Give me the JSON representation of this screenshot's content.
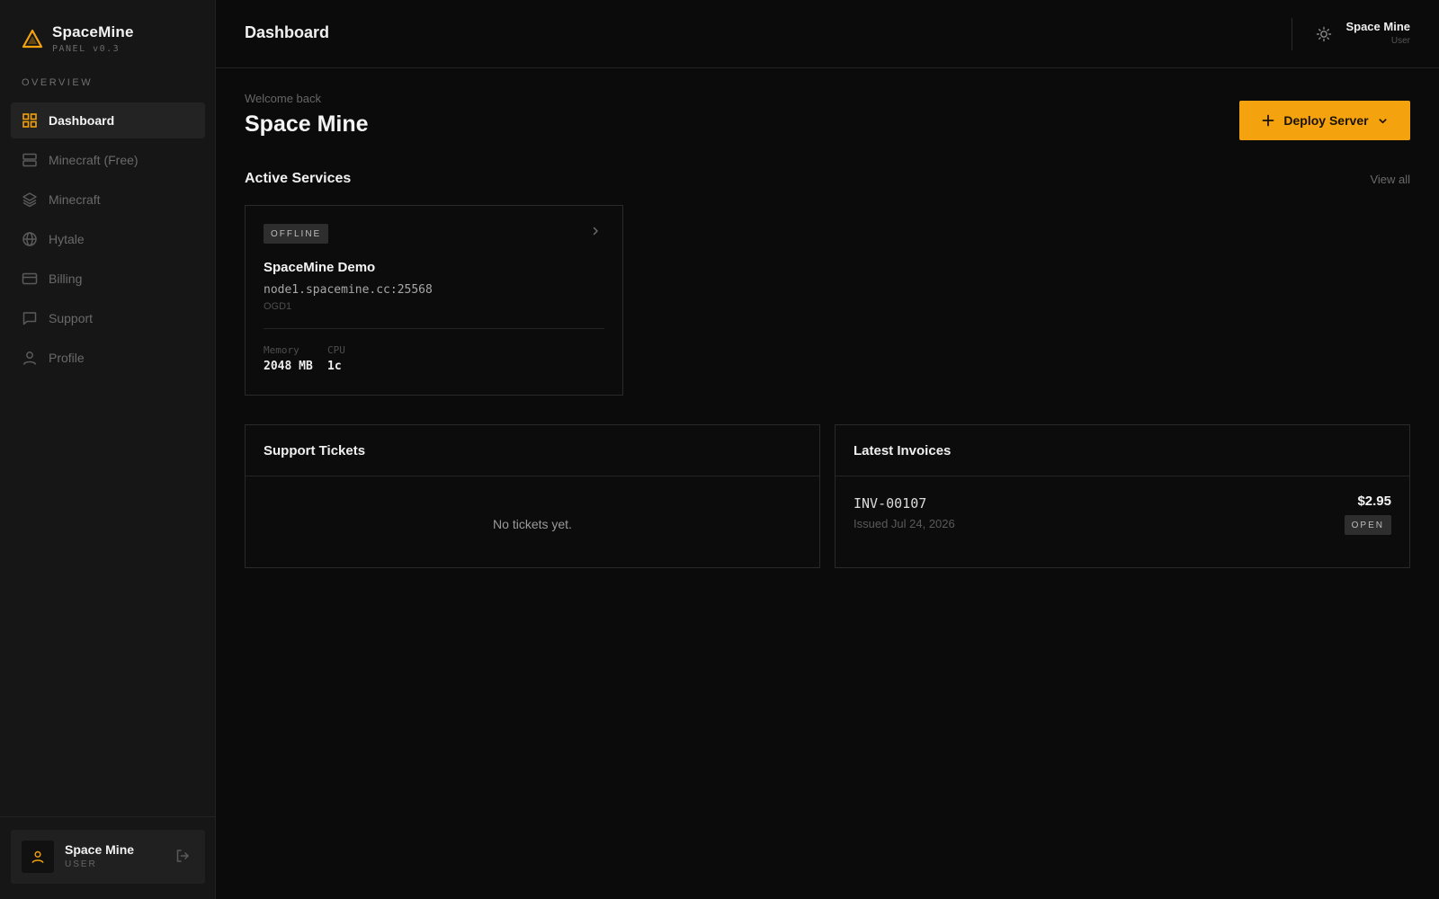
{
  "brand": {
    "name": "SpaceMine",
    "version": "PANEL v0.3",
    "accent": "#f4a20e"
  },
  "sidebar": {
    "section_label": "OVERVIEW",
    "items": [
      {
        "label": "Dashboard",
        "icon": "grid-icon",
        "active": true
      },
      {
        "label": "Minecraft (Free)",
        "icon": "server-icon",
        "active": false
      },
      {
        "label": "Minecraft",
        "icon": "layers-icon",
        "active": false
      },
      {
        "label": "Hytale",
        "icon": "globe-icon",
        "active": false
      },
      {
        "label": "Billing",
        "icon": "credit-card-icon",
        "active": false
      },
      {
        "label": "Support",
        "icon": "chat-icon",
        "active": false
      },
      {
        "label": "Profile",
        "icon": "user-icon",
        "active": false
      }
    ],
    "user": {
      "name": "Space Mine",
      "role": "USER"
    }
  },
  "topbar": {
    "title": "Dashboard",
    "user": {
      "name": "Space Mine",
      "role": "User"
    }
  },
  "main": {
    "welcome": "Welcome back",
    "greeting": "Space Mine",
    "deploy_label": "Deploy Server",
    "services": {
      "title": "Active Services",
      "view_all": "View all",
      "items": [
        {
          "status": "OFFLINE",
          "name": "SpaceMine Demo",
          "address": "node1.spacemine.cc:25568",
          "node": "OGD1",
          "memory_label": "Memory",
          "memory_value": "2048 MB",
          "cpu_label": "CPU",
          "cpu_value": "1c"
        }
      ]
    },
    "tickets": {
      "title": "Support Tickets",
      "empty": "No tickets yet."
    },
    "invoices": {
      "title": "Latest Invoices",
      "items": [
        {
          "id": "INV-00107",
          "issued": "Issued Jul 24, 2026",
          "amount": "$2.95",
          "status": "OPEN"
        }
      ]
    }
  }
}
